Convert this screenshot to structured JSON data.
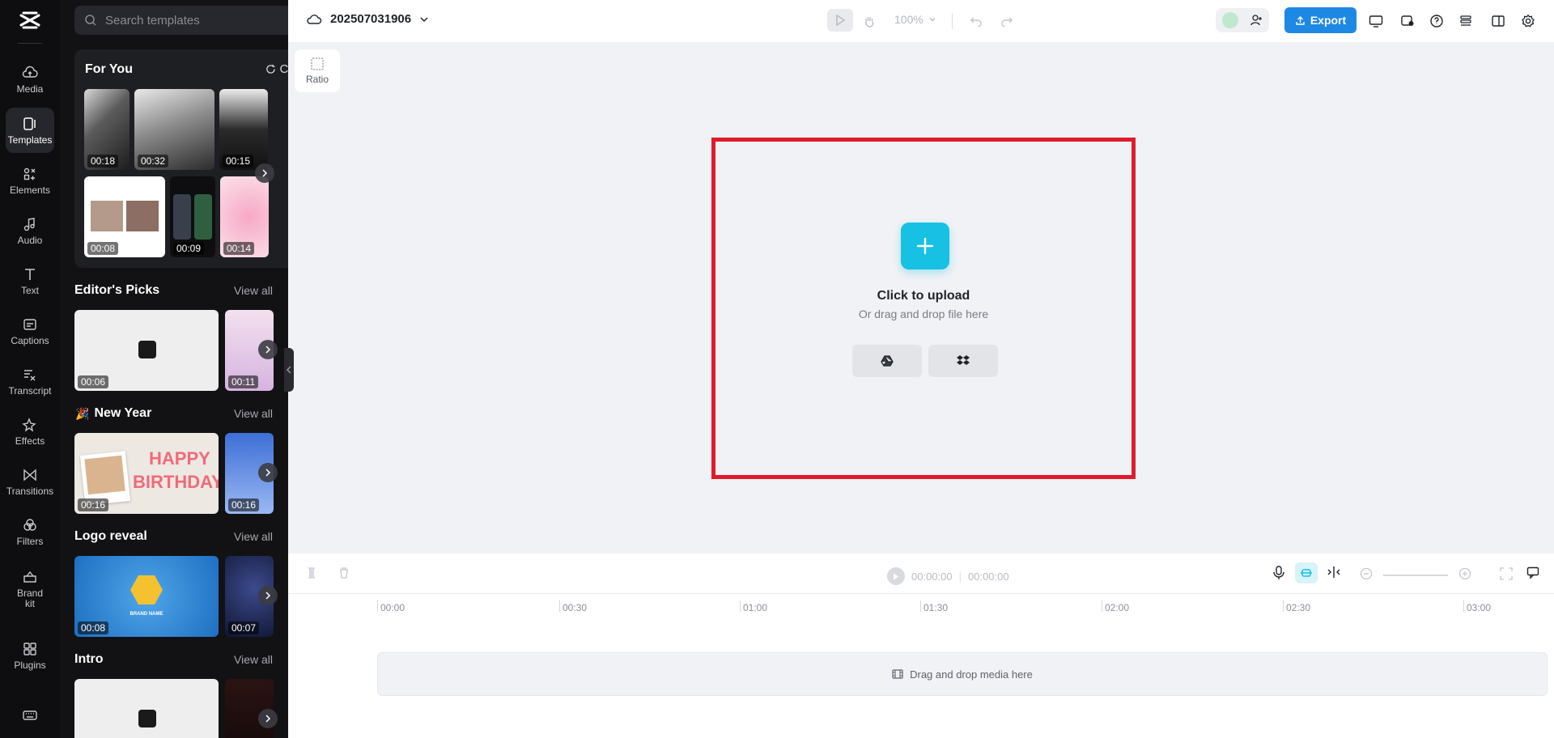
{
  "rail": {
    "items": [
      {
        "label": "Media",
        "icon": "cloud-upload-icon"
      },
      {
        "label": "Templates",
        "icon": "templates-icon",
        "active": true
      },
      {
        "label": "Elements",
        "icon": "elements-icon"
      },
      {
        "label": "Audio",
        "icon": "music-note-icon"
      },
      {
        "label": "Text",
        "icon": "text-icon"
      },
      {
        "label": "Captions",
        "icon": "captions-icon"
      },
      {
        "label": "Transcript",
        "icon": "transcript-icon"
      },
      {
        "label": "Effects",
        "icon": "effects-icon"
      },
      {
        "label": "Transitions",
        "icon": "transitions-icon"
      },
      {
        "label": "Filters",
        "icon": "filters-icon"
      },
      {
        "label": "Brand\nkit",
        "icon": "brand-kit-icon"
      },
      {
        "label": "Plugins",
        "icon": "plugins-icon"
      }
    ]
  },
  "panel": {
    "search_placeholder": "Search templates",
    "for_you": {
      "title": "For You",
      "change_label": "Change",
      "row1": [
        "00:18",
        "00:32",
        "00:15"
      ],
      "row2": [
        "00:08",
        "00:09",
        "00:14"
      ]
    },
    "sections": [
      {
        "title": "Editor's Picks",
        "view_all": "View all",
        "durations": [
          "00:06",
          "00:11"
        ]
      },
      {
        "title": "New Year",
        "view_all": "View all",
        "durations": [
          "00:16",
          "00:16"
        ]
      },
      {
        "title": "Logo reveal",
        "view_all": "View all",
        "durations": [
          "00:08",
          "00:07"
        ]
      },
      {
        "title": "Intro",
        "view_all": "View all",
        "durations": [
          "",
          ""
        ]
      }
    ],
    "thumb_text": {
      "happy": "HAPPY",
      "birthday": "BIRTHDAY",
      "brand_name": "BRAND NAME"
    }
  },
  "topbar": {
    "project_name": "202507031906",
    "zoom": "100%",
    "export_label": "Export"
  },
  "canvas": {
    "ratio_label": "Ratio",
    "upload_title": "Click to upload",
    "upload_subtitle": "Or drag and drop file here"
  },
  "timeline": {
    "current_time": "00:00:00",
    "total_time": "00:00:00",
    "ruler": [
      "00:00",
      "00:30",
      "01:00",
      "01:30",
      "02:00",
      "02:30",
      "03:00"
    ],
    "drop_hint": "Drag and drop media here"
  },
  "colors": {
    "accent": "#16c1e3",
    "export": "#1e88e5",
    "highlight_border": "#e01c2a"
  }
}
